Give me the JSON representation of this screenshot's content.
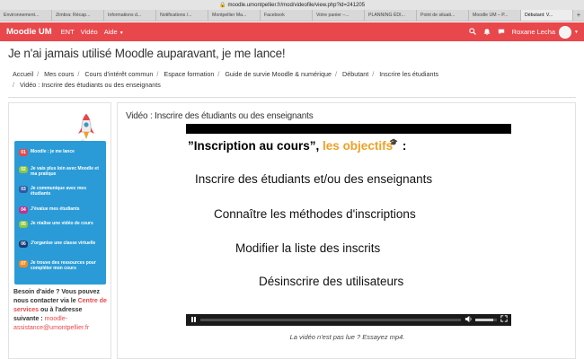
{
  "browser": {
    "url": "moodle.umontpellier.fr/mod/videofile/view.php?id=241205",
    "tabs": [
      {
        "label": "Environnement..."
      },
      {
        "label": "Zimbra: Récap..."
      },
      {
        "label": "Informations d..."
      },
      {
        "label": "Notifications /..."
      },
      {
        "label": "Montpellier Ma..."
      },
      {
        "label": "Facebook"
      },
      {
        "label": "Votre panier –..."
      },
      {
        "label": "PLANNING ÉDI..."
      },
      {
        "label": "Point de situati..."
      },
      {
        "label": "Moodle UM – P..."
      },
      {
        "label": "Débutant: V..."
      }
    ],
    "active_tab_index": 10
  },
  "topbar": {
    "brand": "Moodle UM",
    "nav": [
      {
        "label": "ENT"
      },
      {
        "label": "Vidéo"
      },
      {
        "label": "Aide"
      }
    ],
    "user_name": "Roxane Lecha",
    "brand_color": "#e8474b"
  },
  "page": {
    "title": "Je n'ai jamais utilisé Moodle auparavant, je me lance!",
    "breadcrumb": [
      "Accueil",
      "Mes cours",
      "Cours d'intérêt commun",
      "Espace formation",
      "Guide de survie Moodle & numérique",
      "Débutant",
      "Inscrire les étudiants",
      "Vidéo : Inscrire des étudiants ou des enseignants"
    ]
  },
  "sidebar": {
    "guide_items": [
      {
        "num": "01",
        "text": "Moodle : je me lance",
        "color": "#e8474b"
      },
      {
        "num": "02",
        "text": "Je vais plus loin avec Moodle et ma pratique",
        "color": "#8cc63f"
      },
      {
        "num": "03",
        "text": "Je communique avec mes étudiants",
        "color": "#2b5aa3"
      },
      {
        "num": "04",
        "text": "J'évalue mes étudiants",
        "color": "#c0328b"
      },
      {
        "num": "05",
        "text": "Je réalise une vidéo de cours",
        "color": "#8cc63f"
      },
      {
        "num": "06",
        "text": "J'organise une classe virtuelle",
        "color": "#1c3b74"
      },
      {
        "num": "07",
        "text": "Je trouve des ressources pour compléter mon cours",
        "color": "#f08a24"
      }
    ],
    "help_prefix": "Besoin d'aide ? Vous pouvez nous contacter via le",
    "help_link": "Centre de services",
    "help_middle": "ou à l'adresse suivante :",
    "help_email": "moodle-assistance@umontpellier.fr"
  },
  "main": {
    "title": "Vidéo : Inscrire des étudiants ou des enseignants",
    "slide": {
      "heading_prefix": "”Inscription au cours”,",
      "heading_accent": "les objectifs",
      "heading_suffix": ":",
      "lines": [
        "Inscrire des étudiants et/ou des enseignants",
        "Connaître les méthodes d'inscriptions",
        "Modifier la liste des inscrits",
        "Désinscrire des utilisateurs"
      ]
    },
    "video_progress": 0.0,
    "volume_level": 0.85,
    "fallback_text": "La vidéo n'est pas lue ? Essayez mp4."
  }
}
